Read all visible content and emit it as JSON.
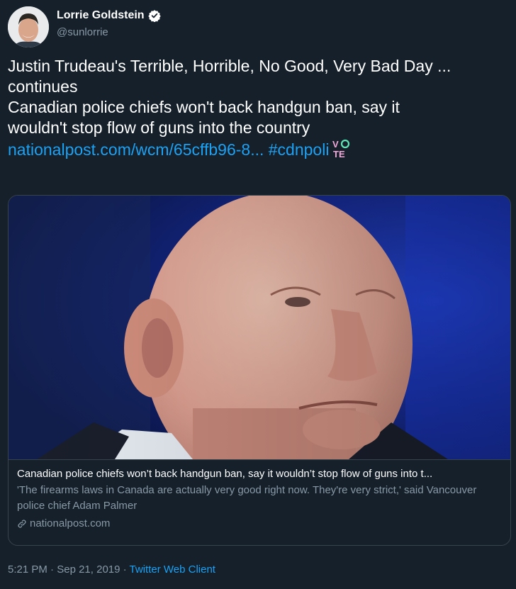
{
  "author": {
    "display_name": "Lorrie Goldstein",
    "handle": "@sunlorrie",
    "verified": true
  },
  "tweet": {
    "line1": "Justin Trudeau's Terrible, Horrible, No Good, Very Bad Day ...",
    "line2": "continues",
    "line3": "Canadian police chiefs won't back handgun ban, say it",
    "line4": "wouldn't stop flow of guns into the country",
    "link_text": "nationalpost.com/wcm/65cffb96-8...",
    "hashtag": "#cdnpoli",
    "vote_badge_top": "V",
    "vote_badge_bottom": "TE"
  },
  "card": {
    "title": "Canadian police chiefs won’t back handgun ban, say it wouldn’t stop flow of guns into t...",
    "description": "'The firearms laws in Canada are actually very good right now. They're very strict,' said Vancouver police chief Adam Palmer",
    "domain": "nationalpost.com"
  },
  "meta": {
    "time": "5:21 PM",
    "separator": "·",
    "date": "Sep 21, 2019",
    "client": "Twitter Web Client"
  },
  "colors": {
    "background": "#15202b",
    "link": "#1da1f2",
    "secondary_text": "#8899a6",
    "border": "#38444d"
  }
}
